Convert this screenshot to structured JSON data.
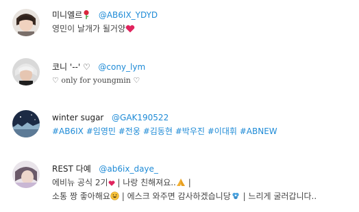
{
  "users": [
    {
      "name": "미니엘르",
      "handle": "@AB6IX_YDYD",
      "bio": "영민이 날개가 될거양",
      "name_icon": "rose-icon",
      "bio_icon": "heart-icon"
    },
    {
      "name": "코니 '--' ♡",
      "handle": "@cony_lym",
      "bio": "♡ only for youngmin ♡"
    },
    {
      "name": "winter sugar",
      "handle": "@GAK190522",
      "tags": [
        "#AB6IX",
        "#임영민",
        "#전웅",
        "#김동현",
        "#박우진",
        "#이대휘",
        "#ABNEW"
      ]
    },
    {
      "name": "REST 다예",
      "handle": "@ab6ix_daye_",
      "bio_line1_a": "에비뉴 공식 2기",
      "bio_line1_b": " | 나랑 친해져요..",
      "bio_line1_c": " |",
      "bio_line2_a": "소통 짱 좋아해요",
      "bio_line2_b": " | 에스크 와주면 감사하겠습니당",
      "bio_line2_c": " | 느리게 굴러갑니다..",
      "icons": [
        "heart-small-icon",
        "praying-hands-icon",
        "grinning-face-icon",
        "flower-icon"
      ]
    }
  ],
  "colors": {
    "handle": "#1d8ad6",
    "heart": "#e0245e"
  }
}
